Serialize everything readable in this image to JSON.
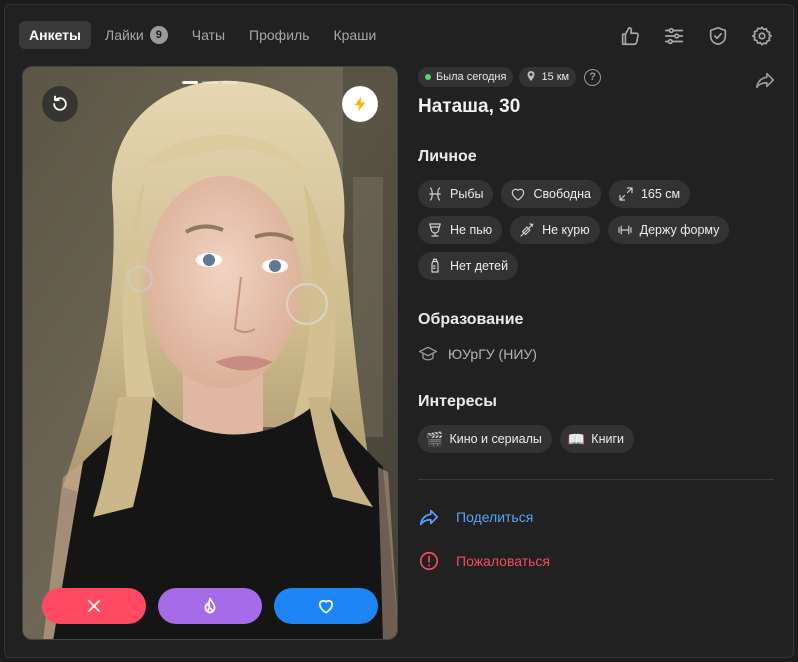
{
  "nav": {
    "tabs": [
      {
        "label": "Анкеты",
        "active": true
      },
      {
        "label": "Лайки",
        "badge": "9"
      },
      {
        "label": "Чаты"
      },
      {
        "label": "Профиль"
      },
      {
        "label": "Краши"
      }
    ],
    "icons": [
      "thumbs-up-icon",
      "filters-icon",
      "shield-check-icon",
      "gear-icon"
    ]
  },
  "photo": {
    "slides_total": 3,
    "slide_active": 1,
    "icons": [
      "undo-icon",
      "lightning-icon"
    ]
  },
  "actions": {
    "icons": [
      "close-icon",
      "flame-icon",
      "heart-icon"
    ],
    "colors": {
      "nope": "#ff4a62",
      "super": "#a66be6",
      "like": "#1e86f4"
    }
  },
  "profile": {
    "status": "Была сегодня",
    "distance": "15 км",
    "help": "?",
    "name": "Наташа, 30"
  },
  "personal": {
    "title": "Личное",
    "chips": [
      {
        "icon": "pisces-icon",
        "label": "Рыбы"
      },
      {
        "icon": "heart-outline-icon",
        "label": "Свободна"
      },
      {
        "icon": "height-icon",
        "label": "165 см"
      },
      {
        "icon": "wine-glass-icon",
        "label": "Не пью"
      },
      {
        "icon": "no-smoking-icon",
        "label": "Не курю"
      },
      {
        "icon": "dumbbell-icon",
        "label": "Держу форму"
      },
      {
        "icon": "baby-bottle-icon",
        "label": "Нет детей"
      }
    ]
  },
  "education": {
    "title": "Образование",
    "value": "ЮУрГУ (НИУ)"
  },
  "interests": {
    "title": "Интересы",
    "chips": [
      {
        "emoji": "🎬",
        "label": "Кино и сериалы"
      },
      {
        "emoji": "📖",
        "label": "Книги"
      }
    ]
  },
  "links": {
    "share": "Поделиться",
    "report": "Пожаловаться"
  }
}
